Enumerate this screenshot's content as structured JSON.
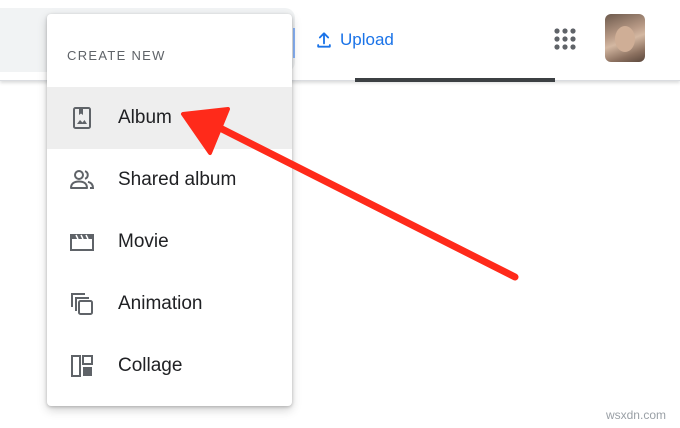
{
  "topbar": {
    "upload_label": "Upload",
    "upload_icon": "upload-icon",
    "apps_icon": "apps-grid-icon",
    "accent": "#1a73e8"
  },
  "menu": {
    "header": "CREATE NEW",
    "items": [
      {
        "label": "Album",
        "icon": "album-icon",
        "highlighted": true
      },
      {
        "label": "Shared album",
        "icon": "people-icon"
      },
      {
        "label": "Movie",
        "icon": "movie-icon"
      },
      {
        "label": "Animation",
        "icon": "animation-icon"
      },
      {
        "label": "Collage",
        "icon": "collage-icon"
      }
    ]
  },
  "annotation": {
    "arrow_color": "#ff2a1a"
  },
  "watermark": "wsxdn.com"
}
